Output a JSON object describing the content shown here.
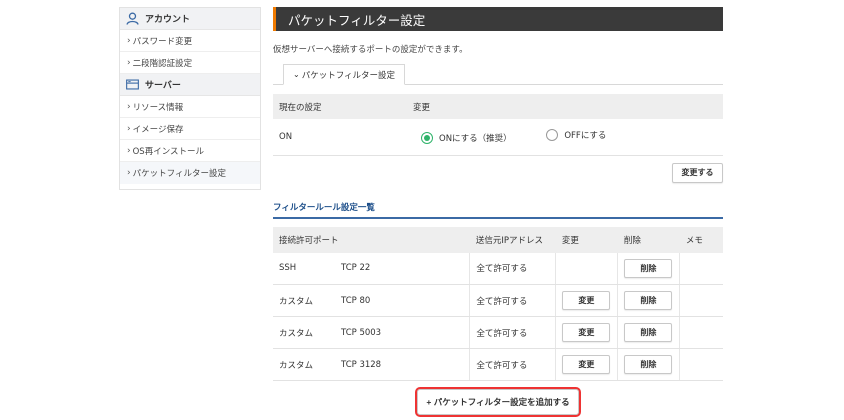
{
  "sidebar": {
    "account": {
      "title": "アカウント",
      "items": [
        {
          "label": "パスワード変更"
        },
        {
          "label": "二段階認証設定"
        }
      ]
    },
    "server": {
      "title": "サーバー",
      "items": [
        {
          "label": "リソース情報"
        },
        {
          "label": "イメージ保存"
        },
        {
          "label": "OS再インストール"
        },
        {
          "label": "パケットフィルター設定"
        }
      ]
    }
  },
  "main": {
    "title": "パケットフィルター設定",
    "description": "仮想サーバーへ接続するポートの設定ができます。",
    "tab_label": "パケットフィルター設定",
    "setting": {
      "col_current": "現在の設定",
      "col_change": "変更",
      "current_value": "ON",
      "option_on": "ONにする（推奨）",
      "option_off": "OFFにする",
      "selected": "on"
    },
    "change_button": "変更する",
    "rules_title": "フィルタールール設定一覧",
    "rules_headers": {
      "port": "接続許可ポート",
      "source_ip": "送信元IPアドレス",
      "edit": "変更",
      "delete": "削除",
      "memo": "メモ"
    },
    "rules": [
      {
        "name": "SSH",
        "port": "TCP 22",
        "source": "全て許可する",
        "edit": "",
        "delete": "削除"
      },
      {
        "name": "カスタム",
        "port": "TCP 80",
        "source": "全て許可する",
        "edit": "変更",
        "delete": "削除"
      },
      {
        "name": "カスタム",
        "port": "TCP 5003",
        "source": "全て許可する",
        "edit": "変更",
        "delete": "削除"
      },
      {
        "name": "カスタム",
        "port": "TCP 3128",
        "source": "全て許可する",
        "edit": "変更",
        "delete": "削除"
      }
    ],
    "add_button": "+ パケットフィルター設定を追加する"
  },
  "colors": {
    "title_bar": "#3a3a3a",
    "accent_orange": "#f07a00",
    "radio_green": "#2fb36a",
    "section_blue": "#1d4f8a",
    "highlight_red": "#ee3333"
  },
  "icons": {
    "account": "user-icon",
    "server": "server-icon",
    "chevron": "chevron-right-icon"
  }
}
